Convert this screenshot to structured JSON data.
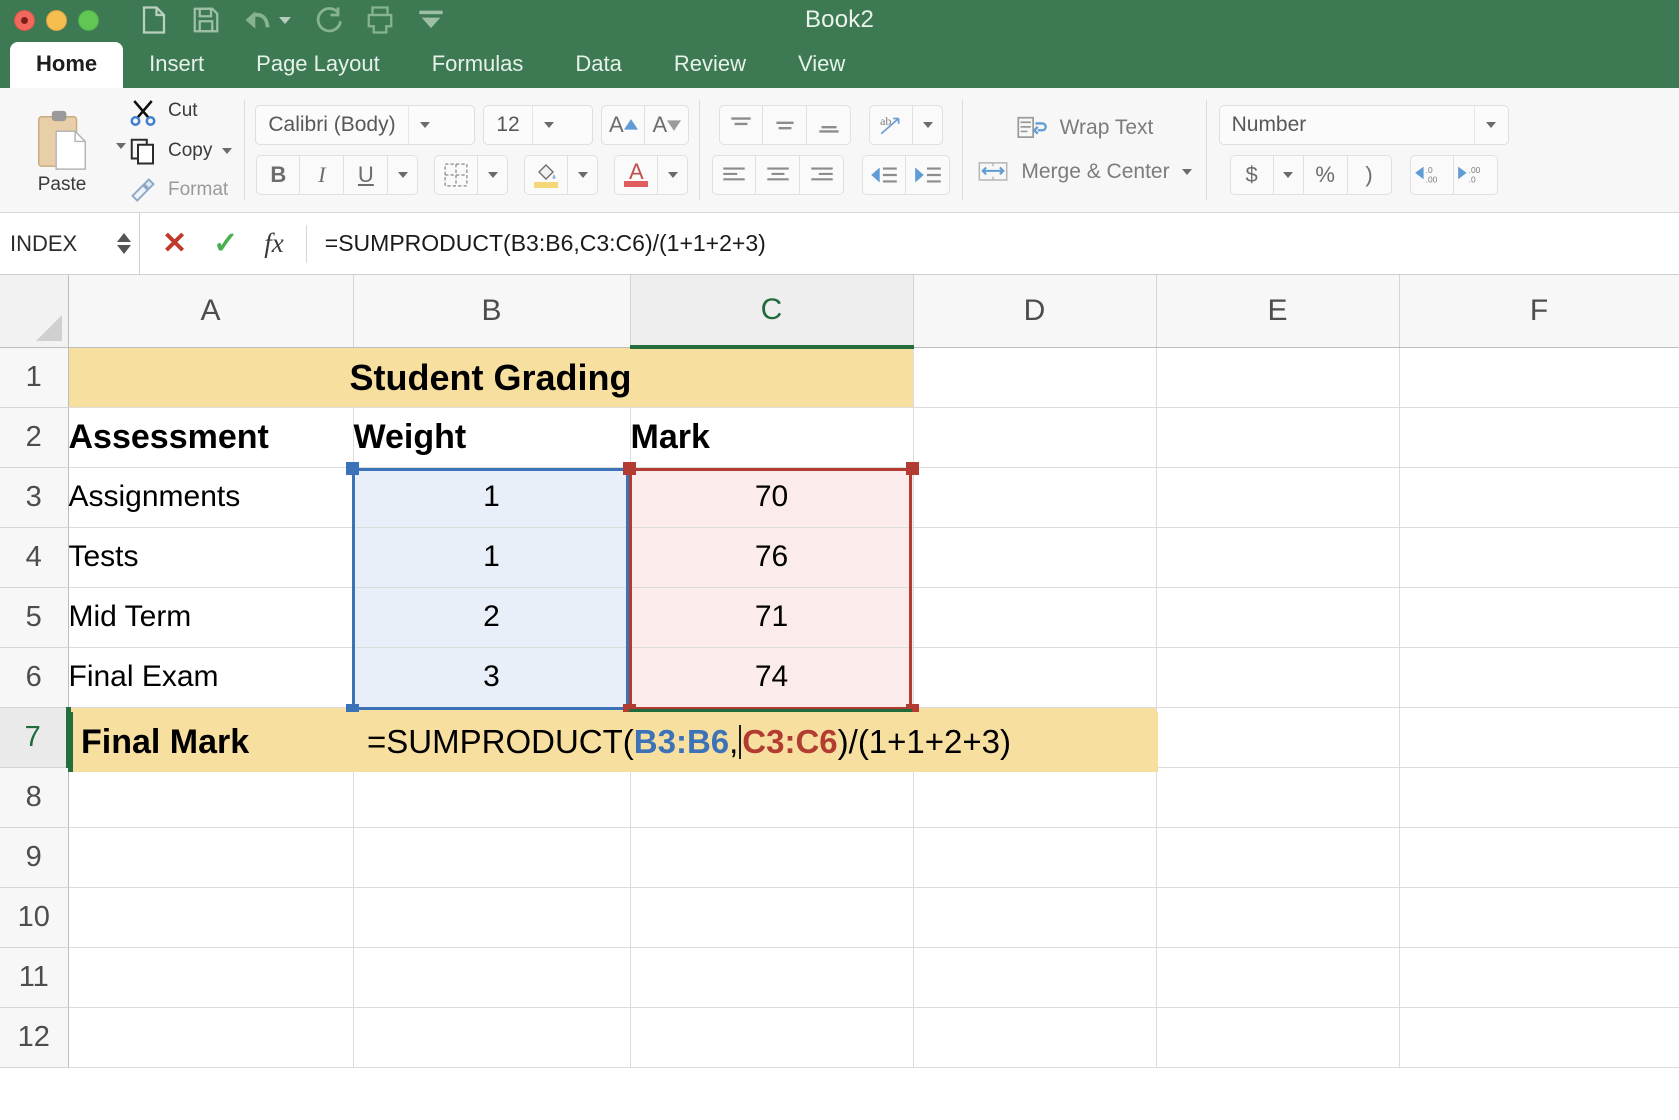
{
  "window": {
    "title": "Book2",
    "traffic_lights": [
      "close",
      "minimize",
      "maximize"
    ],
    "quick_access": [
      "new-icon",
      "save-icon",
      "undo-icon",
      "redo-icon",
      "print-icon",
      "customize-icon"
    ]
  },
  "ribbon": {
    "tabs": [
      {
        "label": "Home",
        "active": true
      },
      {
        "label": "Insert",
        "active": false
      },
      {
        "label": "Page Layout",
        "active": false
      },
      {
        "label": "Formulas",
        "active": false
      },
      {
        "label": "Data",
        "active": false
      },
      {
        "label": "Review",
        "active": false
      },
      {
        "label": "View",
        "active": false
      }
    ],
    "clipboard": {
      "paste_label": "Paste",
      "cut_label": "Cut",
      "copy_label": "Copy",
      "format_label": "Format"
    },
    "font": {
      "family_value": "Calibri (Body)",
      "size_value": "12",
      "grow_label": "A",
      "shrink_label": "A",
      "bold_label": "B",
      "italic_label": "I",
      "underline_label": "U",
      "borders_label": "borders-icon",
      "fill_label": "fill-color-icon",
      "fontcolor_label": "A"
    },
    "alignment": {
      "wrap_text_label": "Wrap Text",
      "merge_center_label": "Merge & Center"
    },
    "number": {
      "format_value": "Number",
      "currency_label": "$",
      "percent_label": "%",
      "comma_label": ")",
      "decrease_decimal_label": ".0\n.00",
      "increase_decimal_label": ".00\n.0"
    }
  },
  "formula_bar": {
    "name_box_value": "INDEX",
    "cancel_label": "✕",
    "enter_label": "✓",
    "function_label": "fx",
    "formula_value": "=SUMPRODUCT(B3:B6,C3:C6)/(1+1+2+3)"
  },
  "sheet": {
    "columns": [
      "A",
      "B",
      "C",
      "D",
      "E",
      "F"
    ],
    "active_column": "C",
    "active_row": 7,
    "rows": [
      {
        "num": "1",
        "cells": [
          {
            "v": "Student Grading",
            "style": "title"
          }
        ]
      },
      {
        "num": "2",
        "cells": [
          {
            "v": "Assessment",
            "style": "hdr"
          },
          {
            "v": "Weight",
            "style": "hdr"
          },
          {
            "v": "Mark",
            "style": "hdr"
          }
        ]
      },
      {
        "num": "3",
        "cells": [
          {
            "v": "Assignments",
            "style": "txt"
          },
          {
            "v": "1",
            "style": "bsel"
          },
          {
            "v": "70",
            "style": "csel"
          }
        ]
      },
      {
        "num": "4",
        "cells": [
          {
            "v": "Tests",
            "style": "txt"
          },
          {
            "v": "1",
            "style": "bsel"
          },
          {
            "v": "76",
            "style": "csel"
          }
        ]
      },
      {
        "num": "5",
        "cells": [
          {
            "v": "Mid Term",
            "style": "txt"
          },
          {
            "v": "2",
            "style": "bsel"
          },
          {
            "v": "71",
            "style": "csel"
          }
        ]
      },
      {
        "num": "6",
        "cells": [
          {
            "v": "Final Exam",
            "style": "txt"
          },
          {
            "v": "3",
            "style": "bsel"
          },
          {
            "v": "74",
            "style": "csel"
          }
        ]
      },
      {
        "num": "7",
        "cells": [
          {
            "v": "Final Mark",
            "style": "goldhdr"
          }
        ]
      },
      {
        "num": "8",
        "cells": []
      },
      {
        "num": "9",
        "cells": []
      },
      {
        "num": "10",
        "cells": []
      },
      {
        "num": "11",
        "cells": []
      },
      {
        "num": "12",
        "cells": []
      }
    ],
    "editing_cell": {
      "address": "B7",
      "prefix": "=SUMPRODUCT(",
      "ref_b": "B3:B6",
      "separator": ",",
      "ref_c": "C3:C6",
      "suffix": ")/(1+1+2+3)"
    },
    "selection_ranges": [
      {
        "name": "weight-range",
        "ref": "B3:B6",
        "color": "#3b72b8"
      },
      {
        "name": "mark-range",
        "ref": "C3:C6",
        "color": "#b23b32"
      }
    ]
  },
  "chart_data": {
    "type": "table",
    "title": "Student Grading",
    "columns": [
      "Assessment",
      "Weight",
      "Mark"
    ],
    "rows": [
      [
        "Assignments",
        1,
        70
      ],
      [
        "Tests",
        1,
        76
      ],
      [
        "Mid Term",
        2,
        71
      ],
      [
        "Final Exam",
        3,
        74
      ]
    ],
    "summary_label": "Final Mark",
    "summary_formula": "=SUMPRODUCT(B3:B6,C3:C6)/(1+1+2+3)"
  }
}
